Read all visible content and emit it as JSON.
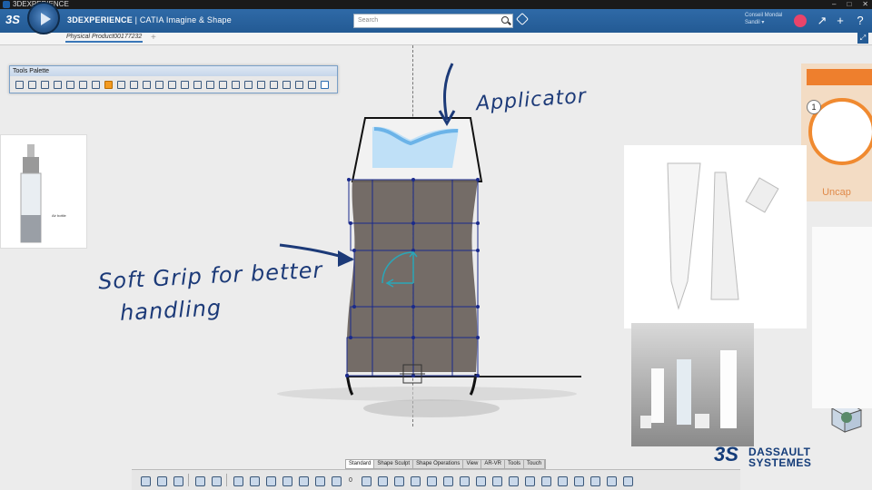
{
  "window": {
    "title": "3DEXPERIENCE",
    "controls": [
      "–",
      "□",
      "✕"
    ]
  },
  "topbar": {
    "brand_strong": "3DEXPERIENCE",
    "brand_rest": " | CATIA  Imagine & Shape",
    "search_placeholder": "Search",
    "user_line1": "Conseil Mondal",
    "user_line2": "Sandil ▾",
    "icons": [
      "share-icon",
      "add-icon",
      "help-icon"
    ]
  },
  "tabs": {
    "active": "Physical Product00177232",
    "add": "+"
  },
  "palette": {
    "title": "Tools Palette",
    "tool_count": 30
  },
  "annotations": {
    "applicator": "Applicator",
    "soft_grip": "Soft Grip for better",
    "handling": "handling"
  },
  "references": {
    "uncap_step": "1",
    "uncap_label": "Uncap",
    "bottle_labels": [
      "Air bottle"
    ]
  },
  "brand": {
    "mark": "3S",
    "line1": "DASSAULT",
    "line2": "SYSTEMES"
  },
  "section_tabs": [
    "Standard",
    "Shape Sculpt",
    "Shape Operations",
    "View",
    "AR-VR",
    "Tools",
    "Touch"
  ],
  "bottom_toolbar": {
    "field_value": "0"
  },
  "colors": {
    "accent": "#235a94",
    "sketch": "#1c3a78",
    "body": "#6e6560",
    "cage": "#1a2a8c"
  }
}
